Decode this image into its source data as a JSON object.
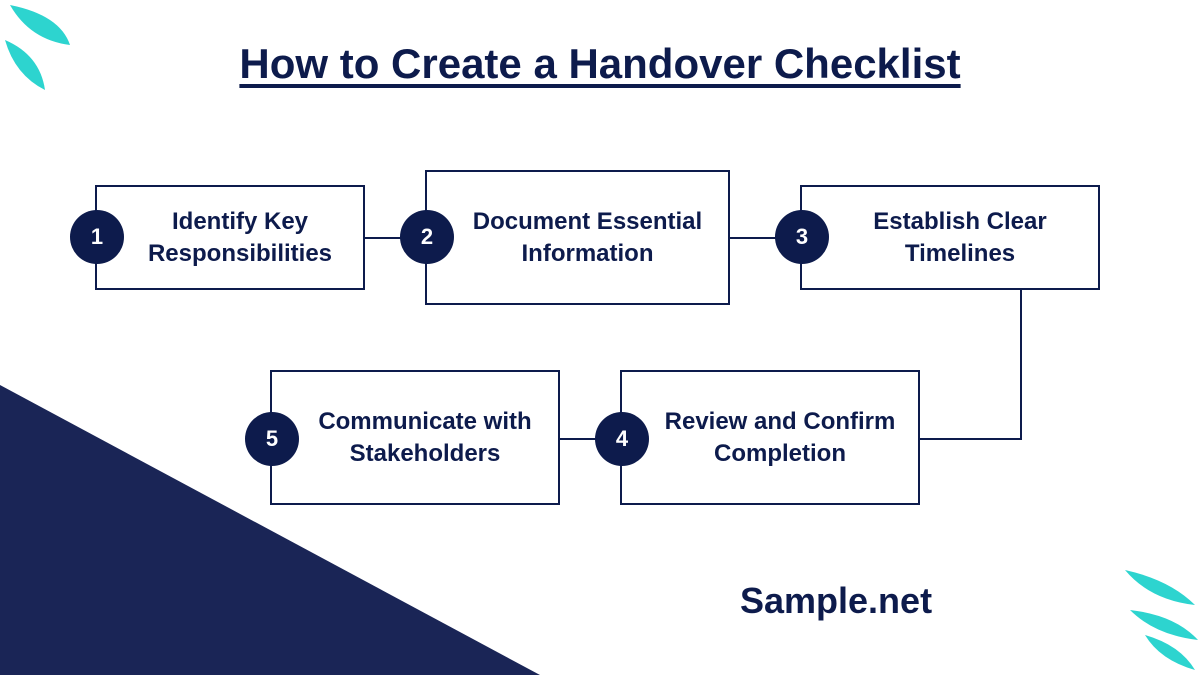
{
  "title": "How to Create a Handover Checklist",
  "branding": "Sample.net",
  "steps": [
    {
      "num": "1",
      "label": "Identify Key Responsibilities"
    },
    {
      "num": "2",
      "label": "Document Essential Information"
    },
    {
      "num": "3",
      "label": "Establish Clear Timelines"
    },
    {
      "num": "4",
      "label": "Review and Confirm Completion"
    },
    {
      "num": "5",
      "label": "Communicate with Stakeholders"
    }
  ],
  "colors": {
    "navy": "#0d1b4c",
    "darknavy": "#1a2556",
    "teal": "#2dd4cf"
  }
}
